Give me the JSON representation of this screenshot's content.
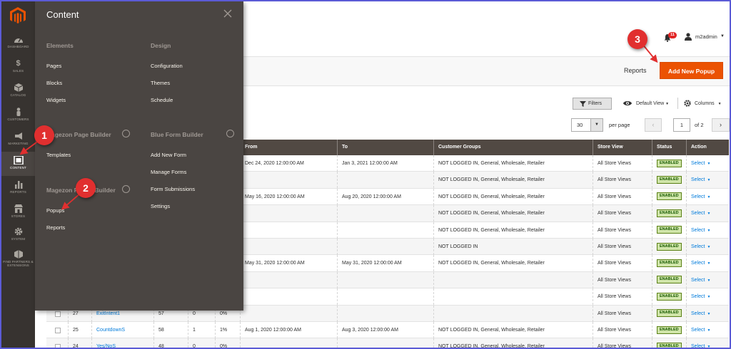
{
  "sidebar": {
    "items": [
      {
        "label": "DASHBOARD",
        "icon": "dashboard-icon"
      },
      {
        "label": "SALES",
        "icon": "dollar-icon"
      },
      {
        "label": "CATALOG",
        "icon": "catalog-cube-icon"
      },
      {
        "label": "CUSTOMERS",
        "icon": "customers-person-icon"
      },
      {
        "label": "MARKETING",
        "icon": "megaphone-icon"
      },
      {
        "label": "CONTENT",
        "icon": "content-layout-icon"
      },
      {
        "label": "REPORTS",
        "icon": "bar-chart-icon"
      },
      {
        "label": "STORES",
        "icon": "store-icon"
      },
      {
        "label": "SYSTEM",
        "icon": "gear-icon"
      },
      {
        "label": "FIND PARTNERS & EXTENSIONS",
        "icon": "extensions-box-icon"
      }
    ],
    "active": "CONTENT",
    "colors": {
      "bg": "#373330",
      "active_bg": "#4a4542",
      "brand": "#eb5202"
    }
  },
  "header": {
    "notifications_count": "11",
    "user_name": "m2admin"
  },
  "page_actions": {
    "reports_label": "Reports",
    "add_button_label": "Add New Popup"
  },
  "grid_toolbar": {
    "filters_label": "Filters",
    "view_label": "Default View",
    "columns_label": "Columns",
    "per_page_value": "30",
    "per_page_label": "per page",
    "current_page": "1",
    "page_total_label": "of 2"
  },
  "flyout": {
    "title": "Content",
    "sections": {
      "elements": {
        "heading": "Elements",
        "items": [
          "Pages",
          "Blocks",
          "Widgets"
        ]
      },
      "design": {
        "heading": "Design",
        "items": [
          "Configuration",
          "Themes",
          "Schedule"
        ]
      },
      "page_builder": {
        "heading": "Magezon Page Builder",
        "items": [
          "Templates"
        ]
      },
      "blue_form": {
        "heading": "Blue Form Builder",
        "items": [
          "Add New Form",
          "Manage Forms",
          "Form Submissions",
          "Settings"
        ]
      },
      "popup_builder": {
        "heading": "Magezon Popup Builder",
        "items": [
          "Popups",
          "Reports"
        ]
      }
    }
  },
  "table": {
    "columns": [
      "From",
      "To",
      "Customer Groups",
      "Store View",
      "Status",
      "Action"
    ],
    "rows": [
      {
        "id": "",
        "name": "",
        "views": "",
        "clicks": "",
        "ctr": "",
        "from": "Dec 24, 2020 12:00:00 AM",
        "to": "Jan 3, 2021 12:00:00 AM",
        "groups": "NOT LOGGED IN, General, Wholesale, Retailer",
        "store": "All Store Views",
        "status": "ENABLED",
        "action": "Select"
      },
      {
        "id": "",
        "name": "",
        "views": "",
        "clicks": "",
        "ctr": "",
        "from": "",
        "to": "",
        "groups": "NOT LOGGED IN, General, Wholesale, Retailer",
        "store": "All Store Views",
        "status": "ENABLED",
        "action": "Select"
      },
      {
        "id": "",
        "name": "",
        "views": "",
        "clicks": "",
        "ctr": "",
        "from": "May 16, 2020 12:00:00 AM",
        "to": "Aug 20, 2020 12:00:00 AM",
        "groups": "NOT LOGGED IN, General, Wholesale, Retailer",
        "store": "All Store Views",
        "status": "ENABLED",
        "action": "Select"
      },
      {
        "id": "",
        "name": "",
        "views": "",
        "clicks": "",
        "ctr": "",
        "from": "",
        "to": "",
        "groups": "NOT LOGGED IN, General, Wholesale, Retailer",
        "store": "All Store Views",
        "status": "ENABLED",
        "action": "Select"
      },
      {
        "id": "",
        "name": "",
        "views": "",
        "clicks": "",
        "ctr": "",
        "from": "",
        "to": "",
        "groups": "NOT LOGGED IN, General, Wholesale, Retailer",
        "store": "All Store Views",
        "status": "ENABLED",
        "action": "Select"
      },
      {
        "id": "",
        "name": "",
        "views": "",
        "clicks": "",
        "ctr": "",
        "from": "",
        "to": "",
        "groups": "NOT LOGGED IN",
        "store": "All Store Views",
        "status": "ENABLED",
        "action": "Select"
      },
      {
        "id": "",
        "name": "",
        "views": "",
        "clicks": "",
        "ctr": "",
        "from": "May 31, 2020 12:00:00 AM",
        "to": "May 31, 2020 12:00:00 AM",
        "groups": "NOT LOGGED IN, General, Wholesale, Retailer",
        "store": "All Store Views",
        "status": "ENABLED",
        "action": "Select"
      },
      {
        "id": "",
        "name": "",
        "views": "",
        "clicks": "",
        "ctr": "",
        "from": "",
        "to": "",
        "groups": "",
        "store": "All Store Views",
        "status": "ENABLED",
        "action": "Select"
      },
      {
        "id": "",
        "name": "",
        "views": "",
        "clicks": "",
        "ctr": "",
        "from": "",
        "to": "",
        "groups": "",
        "store": "All Store Views",
        "status": "ENABLED",
        "action": "Select"
      },
      {
        "id": "27",
        "name": "ExitIntent1",
        "views": "57",
        "clicks": "0",
        "ctr": "0%",
        "from": "",
        "to": "",
        "groups": "",
        "store": "All Store Views",
        "status": "ENABLED",
        "action": "Select"
      },
      {
        "id": "25",
        "name": "CountdownS",
        "views": "58",
        "clicks": "1",
        "ctr": "1%",
        "from": "Aug 1, 2020 12:00:00 AM",
        "to": "Aug 3, 2020 12:00:00 AM",
        "groups": "NOT LOGGED IN, General, Wholesale, Retailer",
        "store": "All Store Views",
        "status": "ENABLED",
        "action": "Select"
      },
      {
        "id": "24",
        "name": "Yes/NoS",
        "views": "48",
        "clicks": "0",
        "ctr": "0%",
        "from": "",
        "to": "",
        "groups": "NOT LOGGED IN, General, Wholesale, Retailer",
        "store": "All Store Views",
        "status": "ENABLED",
        "action": "Select"
      }
    ]
  },
  "callouts": [
    "1",
    "2",
    "3"
  ]
}
